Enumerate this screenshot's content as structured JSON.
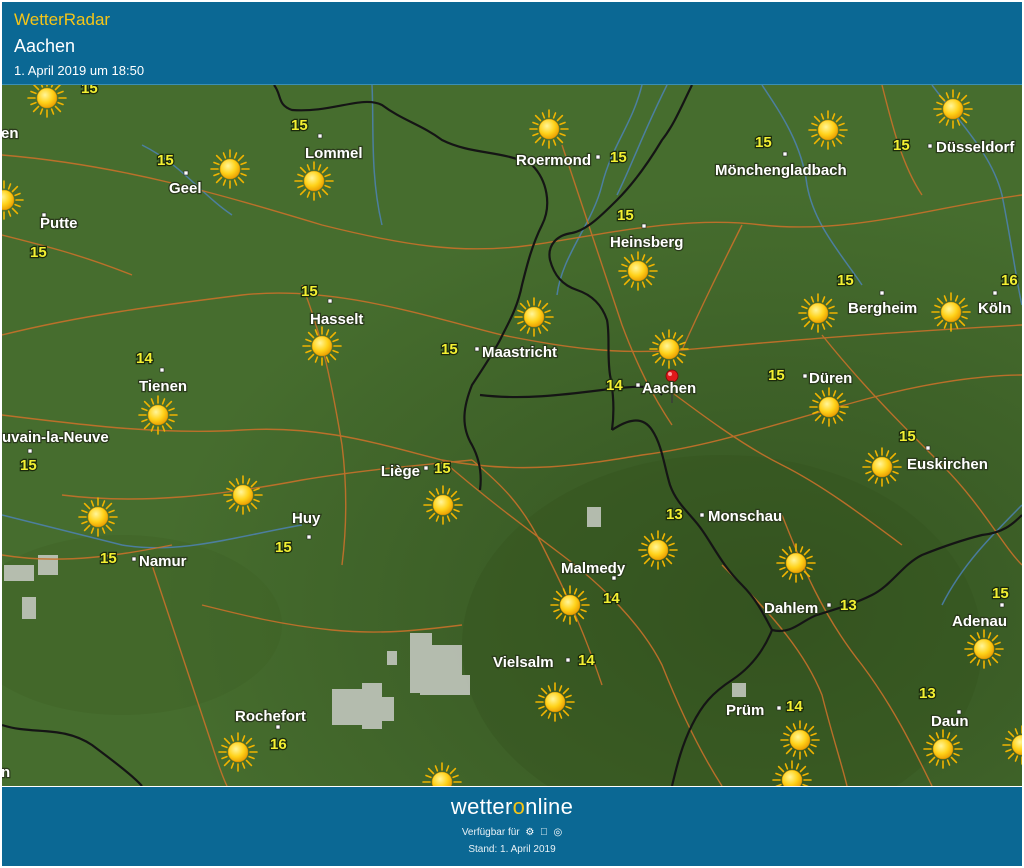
{
  "header": {
    "app_title": "WetterRadar",
    "location": "Aachen",
    "date": "1. April 2019 um 18:50"
  },
  "footer": {
    "brand_pre": "wetter",
    "brand_o": "o",
    "brand_post": "nline",
    "available": "Verfügbar für",
    "stand": "Stand: 1. April 2019",
    "platform_icons": [
      "android-icon",
      "apple-icon",
      "web-icon"
    ]
  },
  "colors": {
    "header_bg": "#0b6894",
    "accent_yellow": "#f5c518",
    "map_green": "#446a2c",
    "temperature": "#f3f032",
    "road": "#c8712a",
    "border": "#141414",
    "river": "#4f86c6",
    "pin": "#e0191b"
  },
  "cities": [
    {
      "id": "lommel",
      "name": "Lommel",
      "temp": "15"
    },
    {
      "id": "geel",
      "name": "Geel",
      "temp": "15"
    },
    {
      "id": "putte",
      "name": "Putte",
      "temp": "15"
    },
    {
      "id": "hasselt",
      "name": "Hasselt",
      "temp": "15"
    },
    {
      "id": "tienen",
      "name": "Tienen",
      "temp": "14"
    },
    {
      "id": "louvain",
      "name": "uvain-la-Neuve",
      "temp": "15"
    },
    {
      "id": "roermond",
      "name": "Roermond",
      "temp": "15"
    },
    {
      "id": "maastricht",
      "name": "Maastricht",
      "temp": "15"
    },
    {
      "id": "heinsberg",
      "name": "Heinsberg",
      "temp": "15"
    },
    {
      "id": "moenchengladbach",
      "name": "Mönchengladbach",
      "temp": "15"
    },
    {
      "id": "duesseldorf",
      "name": "Düsseldorf",
      "temp": "15"
    },
    {
      "id": "bergheim",
      "name": "Bergheim",
      "temp": "15"
    },
    {
      "id": "koeln",
      "name": "Köln",
      "temp": "16"
    },
    {
      "id": "aachen",
      "name": "Aachen",
      "temp": "14"
    },
    {
      "id": "dueren",
      "name": "Düren",
      "temp": "15"
    },
    {
      "id": "euskirchen",
      "name": "Euskirchen",
      "temp": "15"
    },
    {
      "id": "liege",
      "name": "Liège",
      "temp": "15"
    },
    {
      "id": "huy",
      "name": "Huy",
      "temp": "15"
    },
    {
      "id": "namur",
      "name": "Namur",
      "temp": "15"
    },
    {
      "id": "monschau",
      "name": "Monschau",
      "temp": "13"
    },
    {
      "id": "malmedy",
      "name": "Malmedy",
      "temp": "14"
    },
    {
      "id": "dahlem",
      "name": "Dahlem",
      "temp": "13"
    },
    {
      "id": "adenau",
      "name": "Adenau",
      "temp": "15"
    },
    {
      "id": "vielsalm",
      "name": "Vielsalm",
      "temp": "14"
    },
    {
      "id": "pruem",
      "name": "Prüm",
      "temp": "14"
    },
    {
      "id": "rochefort",
      "name": "Rochefort",
      "temp": "16"
    },
    {
      "id": "daun",
      "name": "Daun",
      "temp": "13"
    }
  ],
  "partial_labels": {
    "edge_top_temp": "15",
    "edge_left_upper": "en",
    "edge_left_bottom": "n"
  },
  "weather": {
    "symbol": "sun-icon",
    "count": 36
  }
}
